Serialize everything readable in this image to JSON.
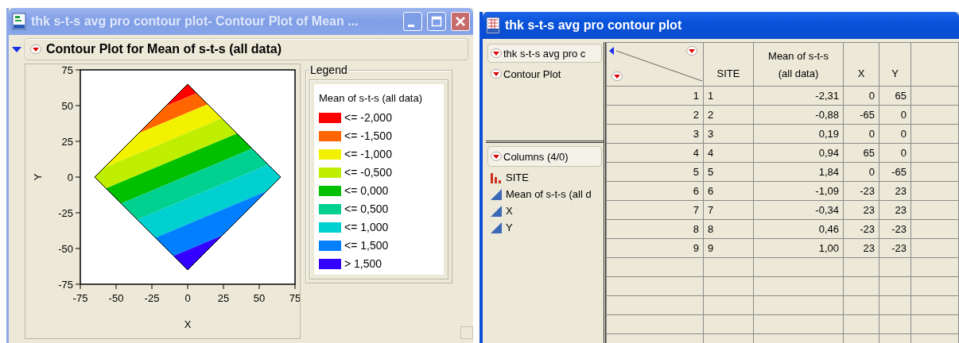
{
  "left_window": {
    "title": "thk s-t-s avg pro contour plot- Contour Plot of Mean ...",
    "outline_title": "Contour Plot for Mean of s-t-s (all data)",
    "plot": {
      "x_label": "X",
      "y_label": "Y",
      "x_ticks": [
        "-75",
        "-50",
        "-25",
        "0",
        "25",
        "50",
        "75"
      ],
      "y_ticks": [
        "75",
        "50",
        "25",
        "0",
        "-25",
        "-50",
        "-75"
      ]
    },
    "legend": {
      "title": "Legend",
      "heading": "Mean of s-t-s (all data)",
      "items": [
        {
          "label": "<= -2,000",
          "color": "#ff0000"
        },
        {
          "label": "<= -1,500",
          "color": "#ff6600"
        },
        {
          "label": "<= -1,000",
          "color": "#f2f200"
        },
        {
          "label": "<= -0,500",
          "color": "#c0ee00"
        },
        {
          "label": "<= 0,000",
          "color": "#00c000"
        },
        {
          "label": "<= 0,500",
          "color": "#00d090"
        },
        {
          "label": "<= 1,000",
          "color": "#00d0d0"
        },
        {
          "label": "<= 1,500",
          "color": "#0080ff"
        },
        {
          "label": "> 1,500",
          "color": "#3300ff"
        }
      ]
    }
  },
  "right_window": {
    "title": "thk s-t-s avg pro contour plot",
    "table_panel": {
      "items": [
        {
          "label": "thk s-t-s avg pro c",
          "selected": true
        },
        {
          "label": "Contour Plot",
          "selected": false
        }
      ]
    },
    "columns_panel": {
      "title": "Columns (4/0)",
      "items": [
        {
          "name": "SITE",
          "kind": "nominal"
        },
        {
          "name": "Mean of s-t-s (all d",
          "kind": "continuous"
        },
        {
          "name": "X",
          "kind": "continuous"
        },
        {
          "name": "Y",
          "kind": "continuous"
        }
      ]
    },
    "grid": {
      "columns": [
        "SITE",
        "Mean of s-t-s\n(all data)",
        "X",
        "Y"
      ],
      "rows": [
        {
          "row_number": "1",
          "cells": [
            "1",
            "-2,31",
            "0",
            "65"
          ]
        },
        {
          "row_number": "2",
          "cells": [
            "2",
            "-0,88",
            "-65",
            "0"
          ]
        },
        {
          "row_number": "3",
          "cells": [
            "3",
            "0,19",
            "0",
            "0"
          ]
        },
        {
          "row_number": "4",
          "cells": [
            "4",
            "0,94",
            "65",
            "0"
          ]
        },
        {
          "row_number": "5",
          "cells": [
            "5",
            "1,84",
            "0",
            "-65"
          ]
        },
        {
          "row_number": "6",
          "cells": [
            "6",
            "-1,09",
            "-23",
            "23"
          ]
        },
        {
          "row_number": "7",
          "cells": [
            "7",
            "-0,34",
            "23",
            "23"
          ]
        },
        {
          "row_number": "8",
          "cells": [
            "8",
            "0,46",
            "-23",
            "-23"
          ]
        },
        {
          "row_number": "9",
          "cells": [
            "9",
            "1,00",
            "23",
            "-23"
          ]
        }
      ]
    }
  }
}
